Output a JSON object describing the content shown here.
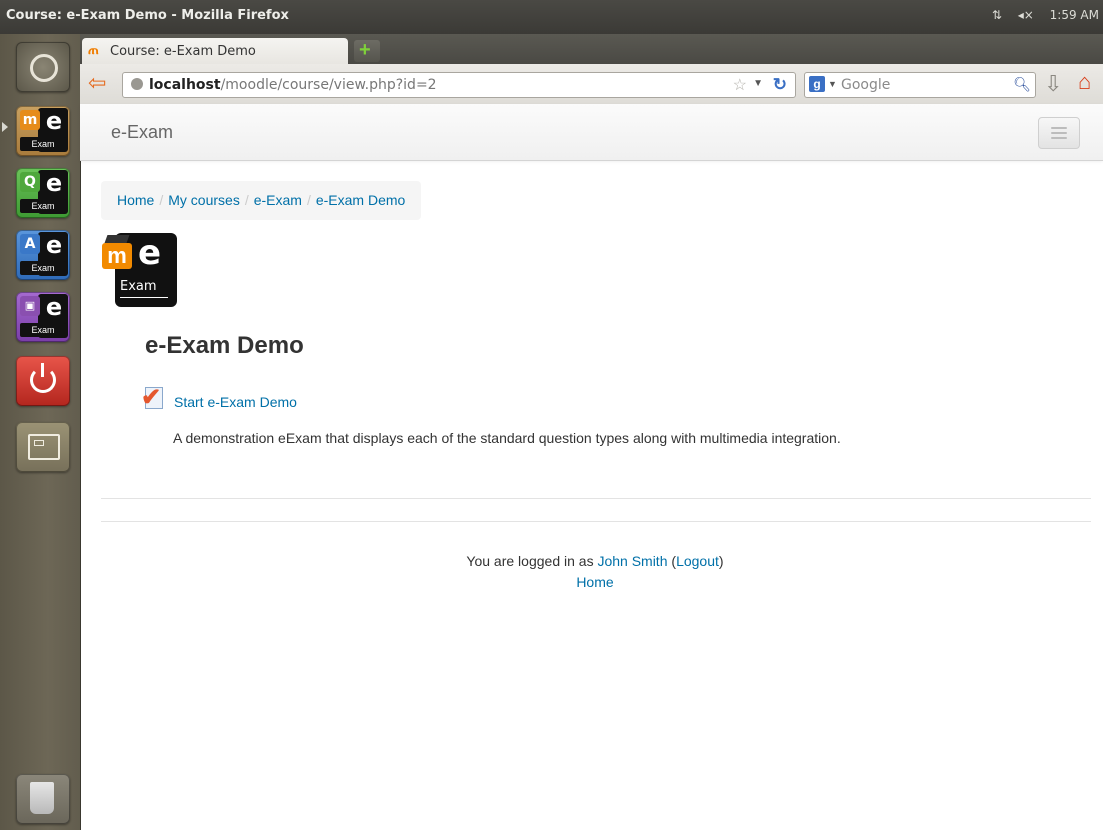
{
  "window": {
    "title": "Course: e-Exam Demo - Mozilla Firefox",
    "time": "1:59 AM",
    "network_icon": "network-icon",
    "sound_icon": "sound-muted-icon"
  },
  "launcher": {
    "items": [
      {
        "name": "moodle-exam",
        "badge": "m",
        "color": "#e68c1a"
      },
      {
        "name": "quiz-exam",
        "badge": "Q",
        "color": "#4fa83c"
      },
      {
        "name": "answer-exam",
        "badge": "A",
        "color": "#3a78c8"
      },
      {
        "name": "media-exam",
        "badge": "▣",
        "color": "#8a4fb0"
      },
      {
        "name": "shutdown",
        "icon": "power-icon",
        "color": "#d9342b"
      },
      {
        "name": "workspaces",
        "icon": "workspace-icon",
        "color": "#8c8468"
      },
      {
        "name": "trash",
        "icon": "trash-icon",
        "color": "#7a7668"
      }
    ],
    "tile_label": "Exam",
    "tile_letter": "e"
  },
  "browser": {
    "tab_title": "Course: e-Exam Demo",
    "tab_favicon": "ጠ",
    "new_tab": "+",
    "url_host": "localhost",
    "url_path": "/moodle/course/view.php?id=2",
    "search_placeholder": "Google",
    "search_engine_letter": "g"
  },
  "moodle": {
    "brand": "e-Exam",
    "breadcrumb": [
      "Home",
      "My courses",
      "e-Exam",
      "e-Exam Demo"
    ],
    "crumb_separator": "/",
    "logo": {
      "letter": "e",
      "label": "Exam",
      "badge": "m"
    },
    "course_title": "e-Exam Demo",
    "activity": {
      "link_text": "Start e-Exam Demo",
      "description": "A demonstration eExam that displays each of the standard question types along with multimedia integration."
    },
    "footer": {
      "logged_in_prefix": "You are logged in as ",
      "user_name": "John Smith",
      "open_paren": " (",
      "logout": "Logout",
      "close_paren": ")",
      "home": "Home"
    }
  }
}
